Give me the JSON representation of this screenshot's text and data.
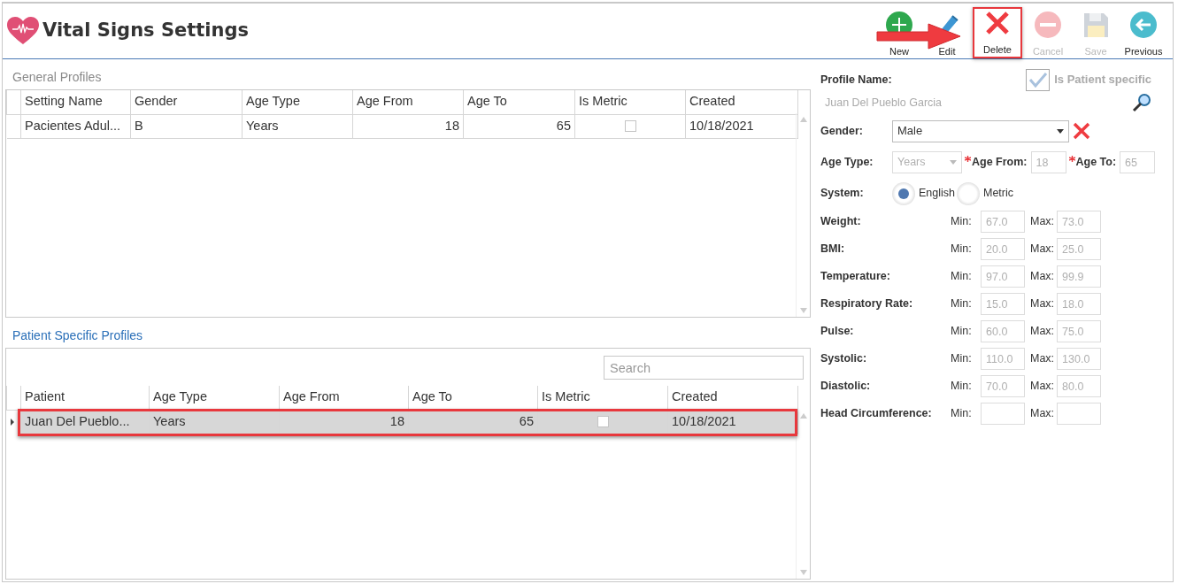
{
  "window": {
    "title": "Vital Signs Settings"
  },
  "toolbar": [
    {
      "kind": "new",
      "label": "New",
      "disabled": false,
      "highlighted": false
    },
    {
      "kind": "edit",
      "label": "Edit",
      "disabled": false,
      "highlighted": false
    },
    {
      "kind": "delete",
      "label": "Delete",
      "disabled": false,
      "highlighted": true
    },
    {
      "kind": "cancel",
      "label": "Cancel",
      "disabled": true,
      "highlighted": false
    },
    {
      "kind": "save",
      "label": "Save",
      "disabled": true,
      "highlighted": false
    },
    {
      "kind": "previous",
      "label": "Previous",
      "disabled": false,
      "highlighted": false
    }
  ],
  "general_profiles": {
    "title": "General Profiles",
    "columns": [
      {
        "label": "Setting Name",
        "kind": "text"
      },
      {
        "label": "Gender",
        "kind": "text"
      },
      {
        "label": "Age Type",
        "kind": "text"
      },
      {
        "label": "Age From",
        "kind": "number"
      },
      {
        "label": "Age To",
        "kind": "number"
      },
      {
        "label": "Is Metric",
        "kind": "check"
      },
      {
        "label": "Created",
        "kind": "text"
      }
    ],
    "rows": [
      {
        "cells": [
          "Pacientes Adul...",
          "B",
          "Years",
          "18",
          "65",
          false,
          "10/18/2021"
        ],
        "selected": false,
        "highlighted": false
      }
    ]
  },
  "patient_profiles": {
    "title": "Patient Specific Profiles",
    "search": {
      "placeholder": "Search"
    },
    "columns": [
      {
        "label": "Patient",
        "kind": "text"
      },
      {
        "label": "Age Type",
        "kind": "text"
      },
      {
        "label": "Age From",
        "kind": "number"
      },
      {
        "label": "Age To",
        "kind": "number"
      },
      {
        "label": "Is Metric",
        "kind": "check"
      },
      {
        "label": "Created",
        "kind": "text"
      }
    ],
    "rows": [
      {
        "cells": [
          "Juan Del Pueblo...",
          "Years",
          "18",
          "65",
          false,
          "10/18/2021"
        ],
        "selected": true,
        "highlighted": true
      }
    ]
  },
  "form": {
    "profile_name": {
      "label": "Profile Name:",
      "value": "Juan Del Pueblo Garcia"
    },
    "is_patient_specific": {
      "label": "Is Patient specific",
      "checked": true,
      "disabled": true
    },
    "gender": {
      "label": "Gender:",
      "value": "Male"
    },
    "age_type": {
      "label": "Age Type:",
      "value": "Years"
    },
    "age_from": {
      "label": "Age From:",
      "value": "18",
      "required": true
    },
    "age_to": {
      "label": "Age To:",
      "value": "65",
      "required": true
    },
    "system": {
      "label": "System:",
      "options": [
        {
          "label": "English",
          "selected": true
        },
        {
          "label": "Metric",
          "selected": false
        }
      ]
    },
    "measures": [
      {
        "label": "Weight:",
        "min_label": "Min:",
        "min": "67.0",
        "max_label": "Max:",
        "max": "73.0"
      },
      {
        "label": "BMI:",
        "min_label": "Min:",
        "min": "20.0",
        "max_label": "Max:",
        "max": "25.0"
      },
      {
        "label": "Temperature:",
        "min_label": "Min:",
        "min": "97.0",
        "max_label": "Max:",
        "max": "99.9"
      },
      {
        "label": "Respiratory Rate:",
        "min_label": "Min:",
        "min": "15.0",
        "max_label": "Max:",
        "max": "18.0"
      },
      {
        "label": "Pulse:",
        "min_label": "Min:",
        "min": "60.0",
        "max_label": "Max:",
        "max": "75.0"
      },
      {
        "label": "Systolic:",
        "min_label": "Min:",
        "min": "110.0",
        "max_label": "Max:",
        "max": "130.0"
      },
      {
        "label": "Diastolic:",
        "min_label": "Min:",
        "min": "70.0",
        "max_label": "Max:",
        "max": "80.0"
      },
      {
        "label": "Head Circumference:",
        "min_label": "Min:",
        "max_label": "Max:"
      }
    ]
  }
}
